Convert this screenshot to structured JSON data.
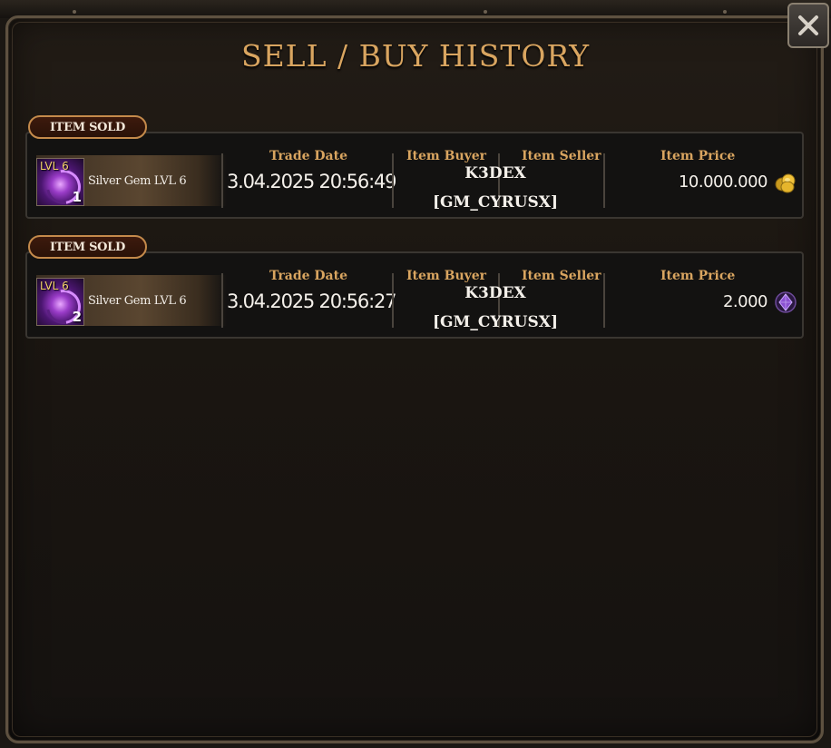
{
  "window": {
    "title": "SELL / BUY HISTORY",
    "close_icon": "close-x-icon"
  },
  "columns": {
    "trade_date": "Trade Date",
    "item_buyer": "Item Buyer",
    "item_seller": "Item Seller",
    "item_price": "Item Price"
  },
  "records": [
    {
      "badge": "ITEM SOLD",
      "item_name": "Silver Gem LVL 6",
      "item_level": "LVL 6",
      "item_qty": "1",
      "trade_date": "3.04.2025 20:56:49",
      "buyer": "K3DEX",
      "seller": "[GM_CYRUSX]",
      "price": "10.000.000",
      "currency_icon": "gold-coins-icon",
      "currency_color": "#f2c23a"
    },
    {
      "badge": "ITEM SOLD",
      "item_name": "Silver Gem LVL 6",
      "item_level": "LVL 6",
      "item_qty": "2",
      "trade_date": "3.04.2025 20:56:27",
      "buyer": "K3DEX",
      "seller": "[GM_CYRUSX]",
      "price": "2.000",
      "currency_icon": "purple-gem-icon",
      "currency_color": "#8a4fd0"
    }
  ],
  "colors": {
    "accent_gold": "#d9a560",
    "badge_border": "#c48a4b",
    "panel_border": "#5e5140"
  }
}
